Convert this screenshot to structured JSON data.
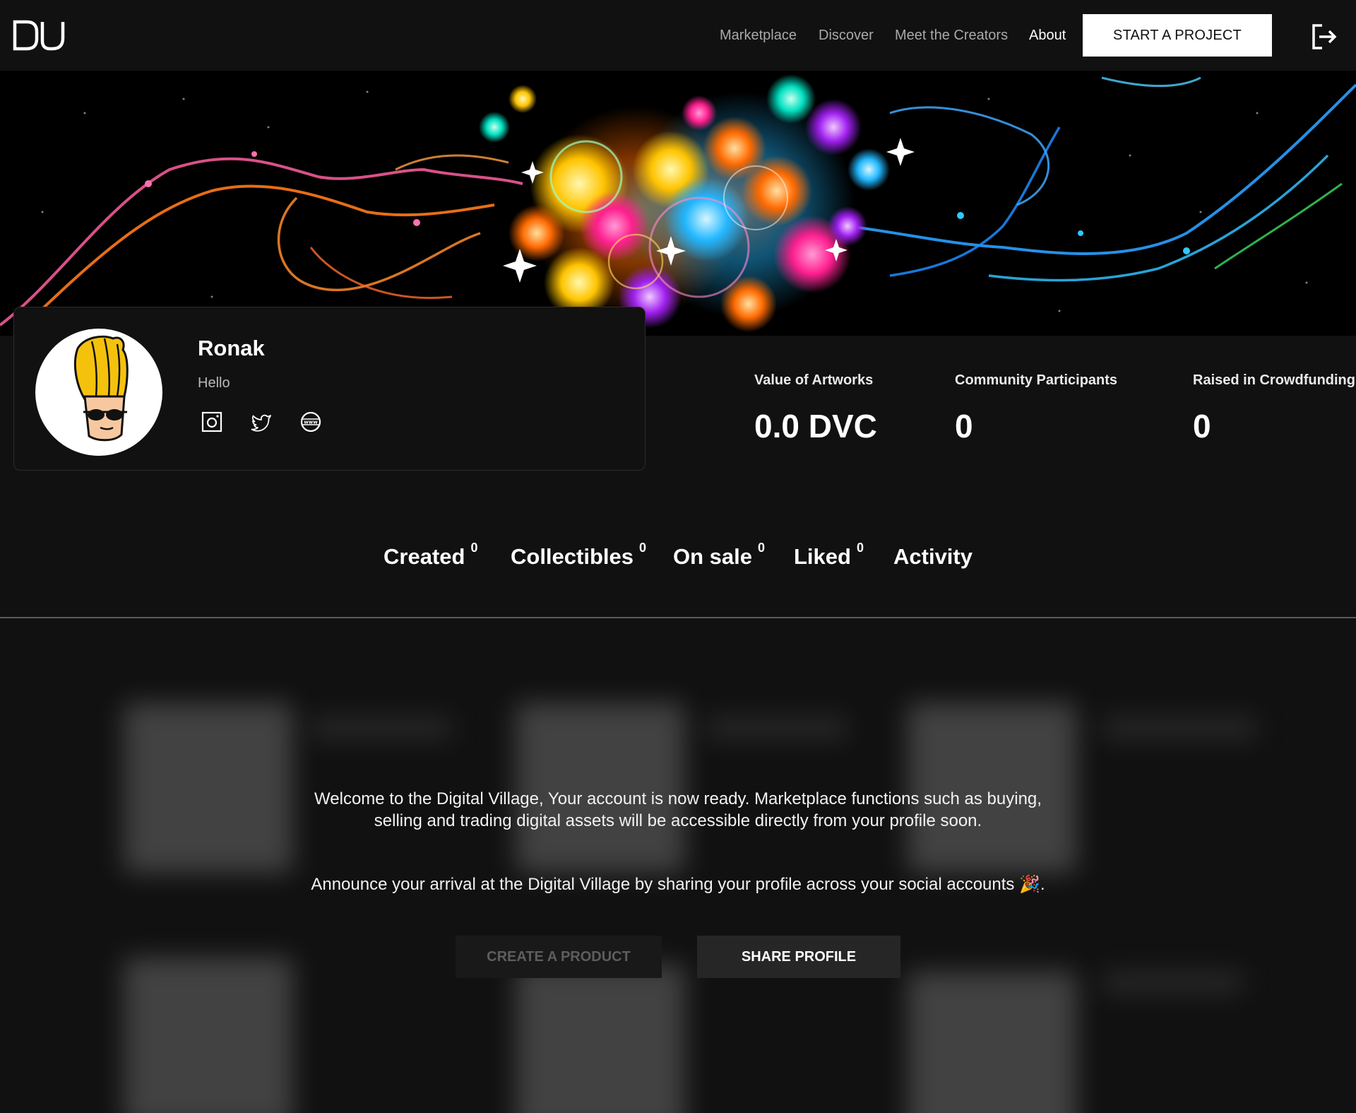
{
  "header": {
    "logo_text": "DV",
    "nav": [
      {
        "label": "Marketplace"
      },
      {
        "label": "Discover"
      },
      {
        "label": "Meet the Creators"
      },
      {
        "label": "About",
        "active": true
      }
    ],
    "cta_label": "START A PROJECT",
    "logout_icon": "logout-icon"
  },
  "profile": {
    "name": "Ronak",
    "bio": "Hello",
    "socials": [
      "instagram-icon",
      "twitter-icon",
      "website-icon"
    ]
  },
  "stats": [
    {
      "label": "Value of Artworks",
      "value": "0.0 DVC"
    },
    {
      "label": "Community Participants",
      "value": "0"
    },
    {
      "label": "Raised in Crowdfunding",
      "value": "0"
    }
  ],
  "tabs": [
    {
      "label": "Created",
      "count": "0"
    },
    {
      "label": "Collectibles",
      "count": "0"
    },
    {
      "label": "On sale",
      "count": "0"
    },
    {
      "label": "Liked",
      "count": "0"
    },
    {
      "label": "Activity",
      "count": ""
    }
  ],
  "welcome": {
    "line1": "Welcome to the Digital Village, Your account is now ready. Marketplace functions such as buying,",
    "line2": "selling and trading digital assets will be accessible directly from your profile soon.",
    "line3": "Announce your arrival at the Digital Village by sharing your profile across your social accounts 🎉.",
    "create_label": "CREATE A PRODUCT",
    "share_label": "SHARE PROFILE"
  },
  "colors": {
    "background": "#111111",
    "text": "#ffffff",
    "muted_text": "#a9a9a9",
    "cta_bg": "#ffffff"
  }
}
